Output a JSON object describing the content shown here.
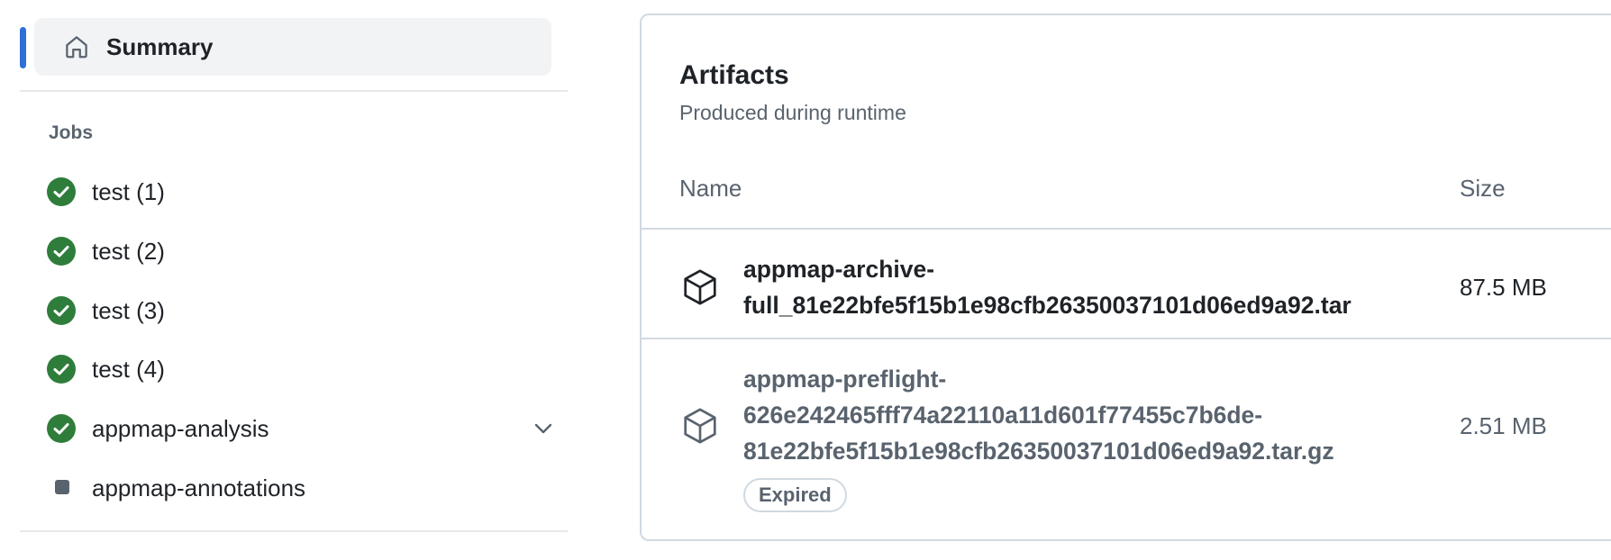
{
  "sidebar": {
    "summary_label": "Summary",
    "summary_icon": "home-icon",
    "jobs_heading": "Jobs",
    "jobs": [
      {
        "label": "test (1)",
        "status": "success",
        "icon": "check-circle-icon"
      },
      {
        "label": "test (2)",
        "status": "success",
        "icon": "check-circle-icon"
      },
      {
        "label": "test (3)",
        "status": "success",
        "icon": "check-circle-icon"
      },
      {
        "label": "test (4)",
        "status": "success",
        "icon": "check-circle-icon"
      },
      {
        "label": "appmap-analysis",
        "status": "success",
        "icon": "check-circle-icon",
        "expandable": true
      },
      {
        "label": "appmap-annotations",
        "status": "skipped",
        "icon": "square-icon"
      }
    ]
  },
  "artifacts": {
    "title": "Artifacts",
    "subtitle": "Produced during runtime",
    "columns": {
      "name": "Name",
      "size": "Size"
    },
    "items": [
      {
        "name": "appmap-archive-full_81e22bfe5f15b1e98cfb26350037101d06ed9a92.tar",
        "name_lines": [
          "appmap-archive-",
          "full_81e22bfe5f15b1e98cfb26350037101d06ed9a92.tar"
        ],
        "size": "87.5 MB",
        "icon": "package-icon",
        "expired": false
      },
      {
        "name": "appmap-preflight-626e242465fff74a22110a11d601f77455c7b6de-81e22bfe5f15b1e98cfb26350037101d06ed9a92.tar.gz",
        "name_lines": [
          "appmap-preflight-",
          "626e242465fff74a22110a11d601f77455c7b6de-",
          "81e22bfe5f15b1e98cfb26350037101d06ed9a92.tar.gz"
        ],
        "size": "2.51 MB",
        "icon": "package-icon",
        "expired": true,
        "badge": "Expired"
      }
    ]
  },
  "colors": {
    "accent": "#2f6fd8",
    "success": "#2f7d3b",
    "muted_text": "#59636e",
    "border": "#d1d9e0"
  }
}
